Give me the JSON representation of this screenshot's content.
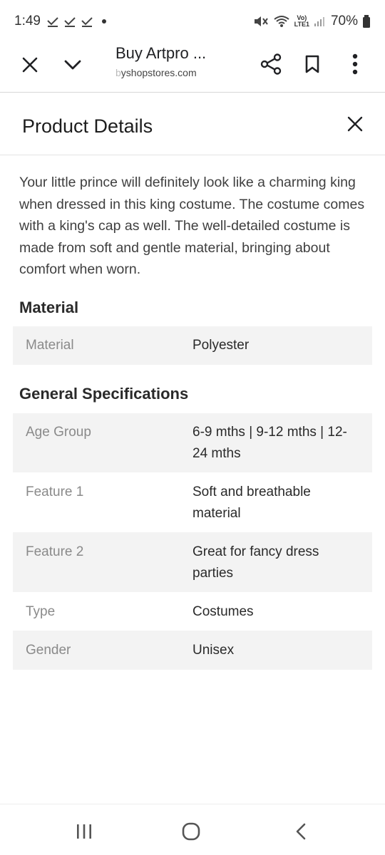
{
  "status_bar": {
    "time": "1:49",
    "battery": "70%",
    "network_label": "Vo) LTE1"
  },
  "browser": {
    "title": "Buy Artpro ...",
    "url_faded": "b",
    "url": "yshopstores.com"
  },
  "panel": {
    "title": "Product Details"
  },
  "description": "Your little prince will definitely look like a charming king when dressed in this king costume. The costume comes with a king's cap as well. The well-detailed costume is made from soft and gentle material, bringing about comfort when worn.",
  "material_section": {
    "heading": "Material",
    "rows": [
      {
        "key": "Material",
        "value": "Polyester"
      }
    ]
  },
  "general_section": {
    "heading": "General Specifications",
    "rows": [
      {
        "key": "Age Group",
        "value": "6-9 mths | 9-12 mths | 12-24 mths"
      },
      {
        "key": "Feature 1",
        "value": "Soft and breathable material"
      },
      {
        "key": "Feature 2",
        "value": "Great for fancy dress parties"
      },
      {
        "key": "Type",
        "value": "Costumes"
      },
      {
        "key": "Gender",
        "value": "Unisex"
      }
    ]
  },
  "icons": {
    "close": "close-icon",
    "chevron": "chevron-down-icon",
    "share": "share-icon",
    "bookmark": "bookmark-icon",
    "more": "more-vert-icon",
    "recents": "recent-apps-icon",
    "home": "home-icon",
    "back": "back-icon"
  }
}
